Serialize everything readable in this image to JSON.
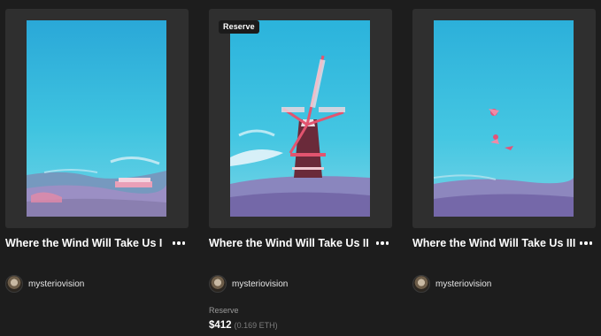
{
  "colors": {
    "background": "#1d1d1d",
    "card": "#2f2f2f",
    "sky": "#3ec4de",
    "accent_pink": "#e2547a"
  },
  "cards": [
    {
      "title": "Where the Wind Will Take Us I",
      "artist": "mysteriovision",
      "more_icon": "more-horizontal-icon"
    },
    {
      "title": "Where the Wind Will Take Us II",
      "badge": "Reserve",
      "artist": "mysteriovision",
      "reserve_label": "Reserve",
      "price": "$412",
      "price_eth": "(0.169 ETH)",
      "more_icon": "more-horizontal-icon"
    },
    {
      "title": "Where the Wind Will Take Us III",
      "artist": "mysteriovision",
      "more_icon": "more-horizontal-icon"
    }
  ]
}
